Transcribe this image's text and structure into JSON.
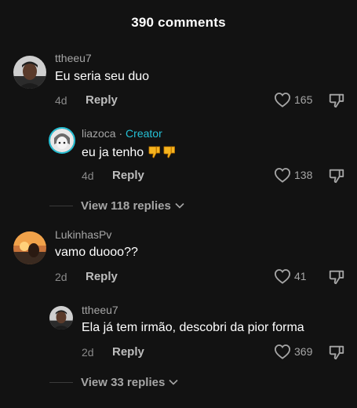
{
  "header": {
    "title": "390 comments"
  },
  "comments": [
    {
      "username": "ttheeu7",
      "text": "Eu seria seu duo",
      "age": "4d",
      "reply_label": "Reply",
      "likes": "165",
      "icon": "avatar-man"
    },
    {
      "username": "liazoca",
      "separator": " · ",
      "badge": "Creator",
      "text": "eu ja tenho",
      "emoji": "thumbs-down-emoji",
      "age": "4d",
      "reply_label": "Reply",
      "likes": "138",
      "icon": "avatar-anime"
    },
    {
      "username": "LukinhasPv",
      "text": "vamo duooo??",
      "age": "2d",
      "reply_label": "Reply",
      "likes": "41",
      "icon": "avatar-sunset"
    },
    {
      "username": "ttheeu7",
      "text": "Ela já tem irmão, descobri da pior forma",
      "age": "2d",
      "reply_label": "Reply",
      "likes": "369",
      "icon": "avatar-man"
    }
  ],
  "view_replies": [
    {
      "label": "View 118 replies"
    },
    {
      "label": "View 33 replies"
    }
  ],
  "colors": {
    "background": "#121212",
    "creator": "#25c1d6",
    "muted": "#a6a6a6"
  }
}
